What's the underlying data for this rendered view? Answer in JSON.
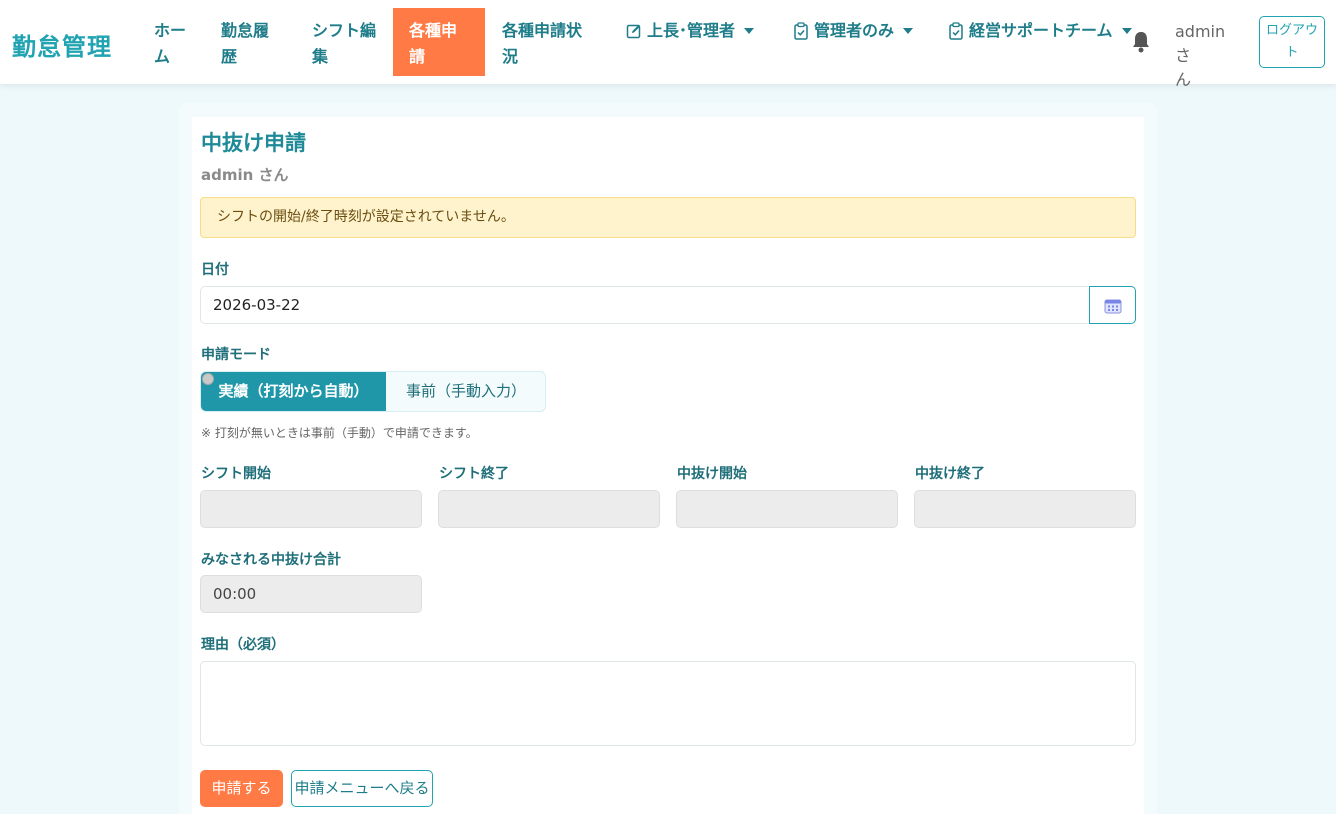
{
  "header": {
    "brand": "勤怠管理",
    "nav": [
      {
        "line1": "ホー",
        "line2": "ム"
      },
      {
        "line1": "勤怠履",
        "line2": "歴"
      },
      {
        "line1": "シフト編",
        "line2": "集"
      },
      {
        "line1": "各種申",
        "line2": "請"
      },
      {
        "line1": "各種申請状",
        "line2": "況"
      }
    ],
    "dropdowns": [
      {
        "label": "上長･管理者",
        "icon": "pencil-square-icon"
      },
      {
        "label": "管理者のみ",
        "icon": "clipboard-check-icon"
      },
      {
        "label": "経営サポートチーム",
        "icon": "clipboard-check-icon"
      }
    ],
    "user_line1": "admin さ",
    "user_line2": "ん",
    "logout_line1": "ログアウ",
    "logout_line2": "ト"
  },
  "form": {
    "title": "中抜け申請",
    "subtitle": "admin さん",
    "alert": "シフトの開始/終了時刻が設定されていません。",
    "date_label": "日付",
    "date_value": "2026-03-22",
    "mode_label": "申請モード",
    "mode_on": "実績（打刻から自動）",
    "mode_off": "事前（手動入力）",
    "mode_hint": "※ 打刻が無いときは事前（手動）で申請できます。",
    "fields": [
      {
        "label": "シフト開始",
        "value": ""
      },
      {
        "label": "シフト終了",
        "value": ""
      },
      {
        "label": "中抜け開始",
        "value": ""
      },
      {
        "label": "中抜け終了",
        "value": ""
      }
    ],
    "total_label": "みなされる中抜け合計",
    "total_value": "00:00",
    "reason_label": "理由（必須）",
    "reason_value": "",
    "submit_label": "申請する",
    "back_label": "申請メニューへ戻る"
  },
  "colors": {
    "accent": "#21a3b2",
    "active": "#ff7a45",
    "alert_bg": "#fff3cd"
  }
}
